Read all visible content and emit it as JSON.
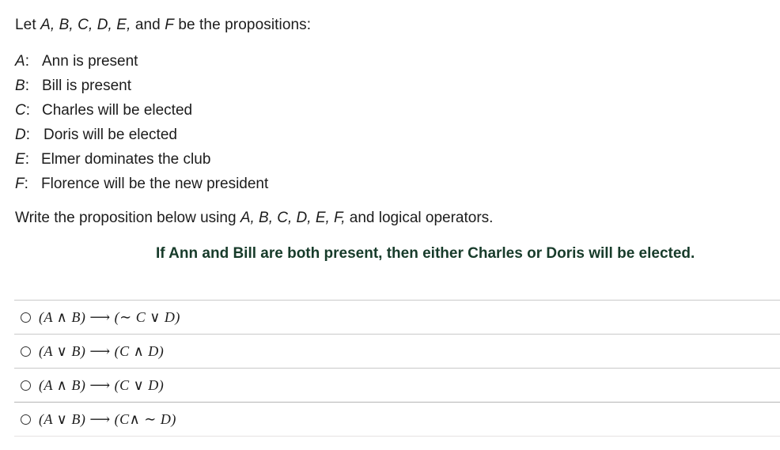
{
  "intro": {
    "prefix": "Let ",
    "variables": "A, B, C, D, E,",
    "middle": " and ",
    "last_variable": "F",
    "suffix": " be the propositions:"
  },
  "definitions": [
    {
      "key": "A",
      "text": "Ann is present"
    },
    {
      "key": "B",
      "text": "Bill is present"
    },
    {
      "key": "C",
      "text": "Charles will be elected"
    },
    {
      "key": "D",
      "text": "Doris will be elected"
    },
    {
      "key": "E",
      "text": "Elmer dominates the club"
    },
    {
      "key": "F",
      "text": "Florence will be the new president"
    }
  ],
  "instruction": {
    "prefix": "Write the proposition below using ",
    "variables": "A, B, C, D, E, F,",
    "suffix": " and logical operators."
  },
  "target_statement": "If Ann and Bill are both present, then either Charles or Doris will be elected.",
  "colors": {
    "target_text": "#173b2a",
    "divider": "#c9c9c9"
  },
  "options": [
    {
      "label": "(A ∧ B) ⟶ (∼ C ∨ D)",
      "selected": false
    },
    {
      "label": "(A ∨ B) ⟶ (C ∧ D)",
      "selected": false
    },
    {
      "label": "(A ∧ B) ⟶ (C ∨ D)",
      "selected": false
    },
    {
      "label": "(A ∨ B) ⟶ (C∧ ∼ D)",
      "selected": false
    }
  ]
}
